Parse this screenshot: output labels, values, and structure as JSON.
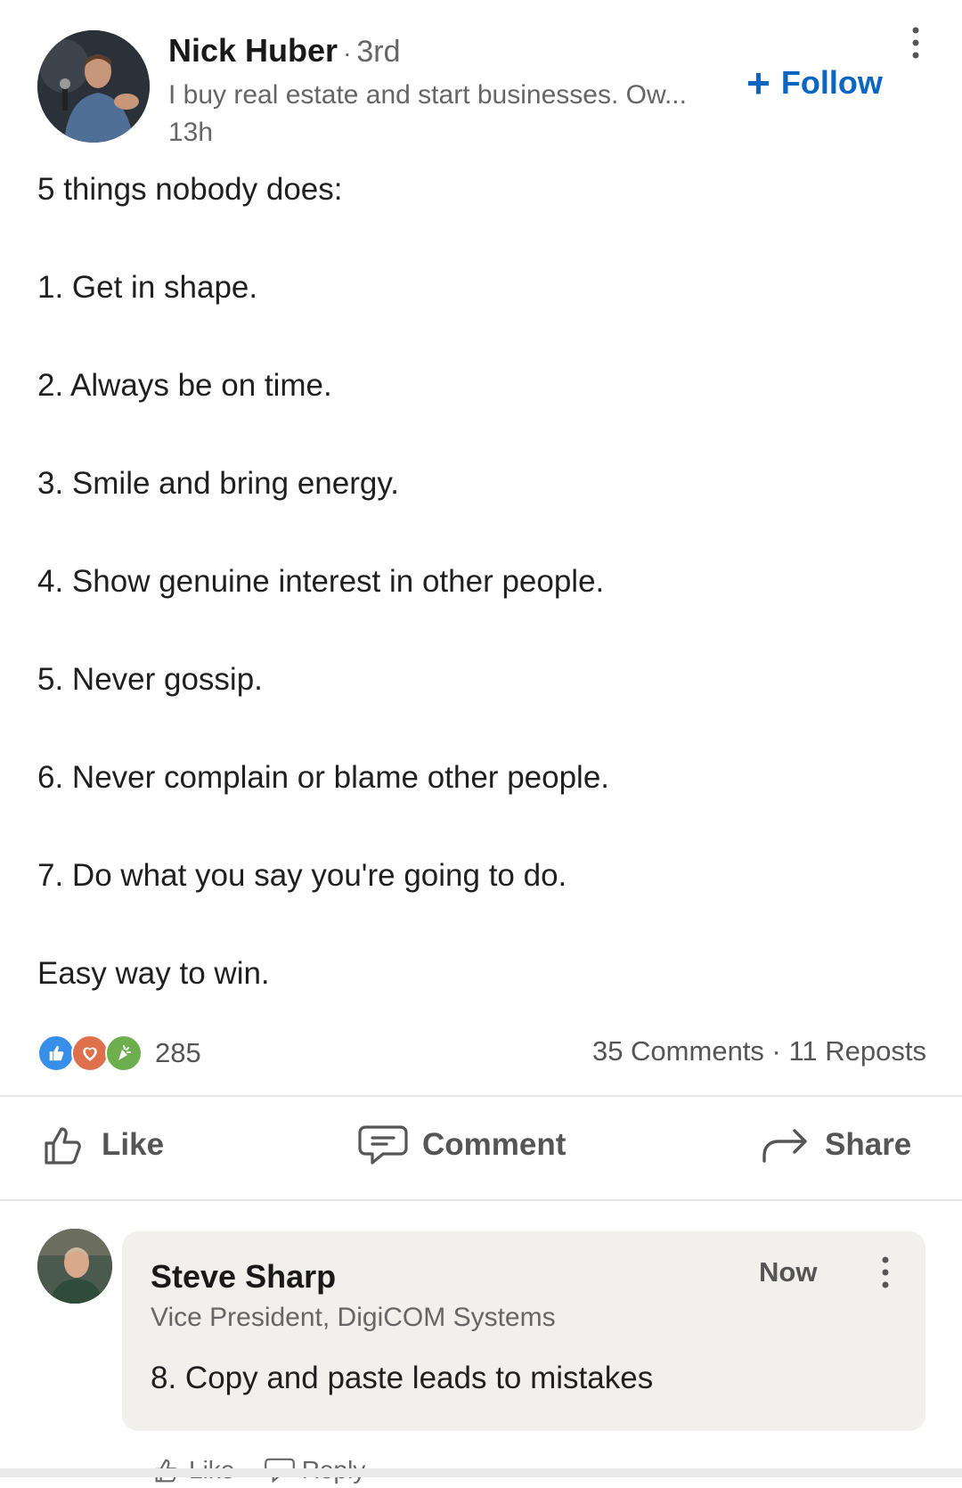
{
  "post": {
    "author": {
      "name": "Nick Huber",
      "degree": "3rd",
      "headline": "I buy real estate and start businesses. Ow...",
      "time": "13h"
    },
    "follow_label": "Follow",
    "body": [
      "5 things nobody does:",
      "1. Get in shape.",
      "2. Always be on time.",
      "3. Smile and bring energy.",
      "4. Show genuine interest in other people.",
      "5. Never gossip.",
      "6. Never complain or blame other people.",
      "7. Do what you say you're going to do.",
      "Easy way to win."
    ],
    "reactions": {
      "count": "285",
      "icons": [
        "like-icon",
        "love-icon",
        "celebrate-icon"
      ],
      "colors": {
        "like": "#378fe9",
        "love": "#df704d",
        "celebrate": "#6dae4f"
      }
    },
    "comments_label": "35 Comments",
    "reposts_label": "11 Reposts"
  },
  "actions": {
    "like": "Like",
    "comment": "Comment",
    "share": "Share"
  },
  "comment": {
    "name": "Steve Sharp",
    "title": "Vice President, DigiCOM Systems",
    "time": "Now",
    "text": "8. Copy and paste leads to mistakes",
    "like_label": "Like",
    "reply_label": "Reply"
  },
  "colors": {
    "accent": "#0a66c2",
    "comment_bg": "#f2f0ec",
    "secondary_text": "#666666"
  }
}
